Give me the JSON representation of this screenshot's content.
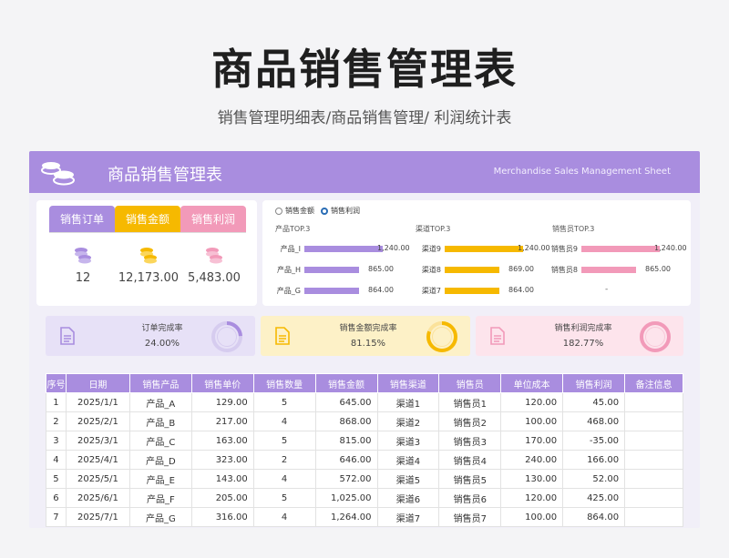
{
  "page": {
    "title": "商品销售管理表",
    "subtitle": "销售管理明细表/商品销售管理/ 利润统计表"
  },
  "banner": {
    "title": "商品销售管理表",
    "subtitle": "Merchandise Sales Management Sheet"
  },
  "kpi": {
    "tabs": [
      {
        "label": "销售订单",
        "value": "12"
      },
      {
        "label": "销售金额",
        "value": "12,173.00"
      },
      {
        "label": "销售利润",
        "value": "5,483.00"
      }
    ],
    "colors": [
      "#a98ddf",
      "#f6b900",
      "#f29ab9"
    ]
  },
  "radio": {
    "opt1": "销售金额",
    "opt2": "销售利润",
    "selected": "销售利润"
  },
  "top3": [
    {
      "title": "产品TOP.3",
      "color": "#a98ddf",
      "items": [
        {
          "label": "产品_I",
          "value": 1240.0,
          "text": "1,240.00"
        },
        {
          "label": "产品_H",
          "value": 865.0,
          "text": "865.00"
        },
        {
          "label": "产品_G",
          "value": 864.0,
          "text": "864.00"
        }
      ]
    },
    {
      "title": "渠道TOP.3",
      "color": "#f6b900",
      "items": [
        {
          "label": "渠道9",
          "value": 1240.0,
          "text": "1,240.00"
        },
        {
          "label": "渠道8",
          "value": 869.0,
          "text": "869.00"
        },
        {
          "label": "渠道7",
          "value": 864.0,
          "text": "864.00"
        }
      ]
    },
    {
      "title": "销售员TOP.3",
      "color": "#f29ab9",
      "items": [
        {
          "label": "销售员9",
          "value": 1240.0,
          "text": "1,240.00"
        },
        {
          "label": "销售员8",
          "value": 865.0,
          "text": "865.00"
        }
      ],
      "extra": "-"
    }
  ],
  "rates": [
    {
      "label": "订单完成率",
      "value": "24.00%",
      "fraction": 0.24,
      "color": "#a98ddf",
      "track": "#d6ccef"
    },
    {
      "label": "销售金额完成率",
      "value": "81.15%",
      "fraction": 0.8115,
      "color": "#f6b900",
      "track": "#fbe29a"
    },
    {
      "label": "销售利润完成率",
      "value": "182.77%",
      "fraction": 1.0,
      "color": "#f29ab9",
      "track": "#f8c9d9"
    }
  ],
  "table": {
    "headers": [
      "序号",
      "日期",
      "销售产品",
      "销售单价",
      "销售数量",
      "销售金额",
      "销售渠道",
      "销售员",
      "单位成本",
      "销售利润",
      "备注信息"
    ],
    "rows": [
      [
        "1",
        "2025/1/1",
        "产品_A",
        "129.00",
        "5",
        "645.00",
        "渠道1",
        "销售员1",
        "120.00",
        "45.00",
        ""
      ],
      [
        "2",
        "2025/2/1",
        "产品_B",
        "217.00",
        "4",
        "868.00",
        "渠道2",
        "销售员2",
        "100.00",
        "468.00",
        ""
      ],
      [
        "3",
        "2025/3/1",
        "产品_C",
        "163.00",
        "5",
        "815.00",
        "渠道3",
        "销售员3",
        "170.00",
        "-35.00",
        ""
      ],
      [
        "4",
        "2025/4/1",
        "产品_D",
        "323.00",
        "2",
        "646.00",
        "渠道4",
        "销售员4",
        "240.00",
        "166.00",
        ""
      ],
      [
        "5",
        "2025/5/1",
        "产品_E",
        "143.00",
        "4",
        "572.00",
        "渠道5",
        "销售员5",
        "130.00",
        "52.00",
        ""
      ],
      [
        "6",
        "2025/6/1",
        "产品_F",
        "205.00",
        "5",
        "1,025.00",
        "渠道6",
        "销售员6",
        "120.00",
        "425.00",
        ""
      ],
      [
        "7",
        "2025/7/1",
        "产品_G",
        "316.00",
        "4",
        "1,264.00",
        "渠道7",
        "销售员7",
        "100.00",
        "864.00",
        ""
      ]
    ]
  }
}
